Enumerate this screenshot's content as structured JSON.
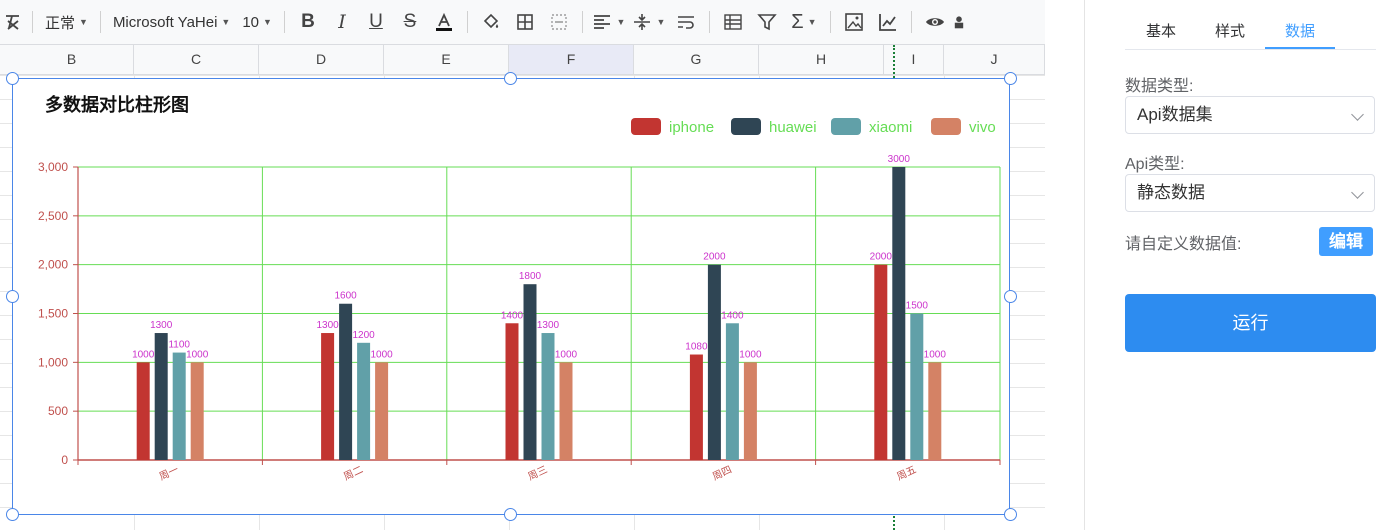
{
  "toolbar": {
    "style_select": "正常",
    "font_select": "Microsoft YaHei",
    "size_select": "10"
  },
  "columns": [
    "B",
    "C",
    "D",
    "E",
    "F",
    "G",
    "H",
    "I",
    "J"
  ],
  "chart_data": {
    "type": "bar",
    "title": "多数据对比柱形图",
    "categories": [
      "周一",
      "周二",
      "周三",
      "周四",
      "周五"
    ],
    "series": [
      {
        "name": "iphone",
        "color": "#c23531",
        "values": [
          1000,
          1300,
          1400,
          1080,
          2000
        ]
      },
      {
        "name": "huawei",
        "color": "#2f4554",
        "values": [
          1300,
          1600,
          1800,
          2000,
          3000
        ]
      },
      {
        "name": "xiaomi",
        "color": "#61a0a8",
        "values": [
          1100,
          1200,
          1300,
          1400,
          1500
        ]
      },
      {
        "name": "vivo",
        "color": "#d48265",
        "values": [
          1000,
          1000,
          1000,
          1000,
          1000
        ]
      }
    ],
    "yticks": [
      "0",
      "500",
      "1,000",
      "1,500",
      "2,000",
      "2,500",
      "3,000"
    ],
    "ylim": [
      0,
      3000
    ],
    "grid": true,
    "legend": "top-right",
    "colors": {
      "grid": "#66dd55",
      "axis": "#c0504d",
      "labels": "#cc33cc",
      "legend_text": "#66dd55"
    }
  },
  "panel": {
    "tabs": [
      "基本",
      "样式",
      "数据"
    ],
    "active_tab": "数据",
    "data_type_label": "数据类型:",
    "data_type_value": "Api数据集",
    "api_type_label": "Api类型:",
    "api_type_value": "静态数据",
    "custom_label": "请自定义数据值:",
    "edit_button": "编辑",
    "run_button": "运行"
  }
}
